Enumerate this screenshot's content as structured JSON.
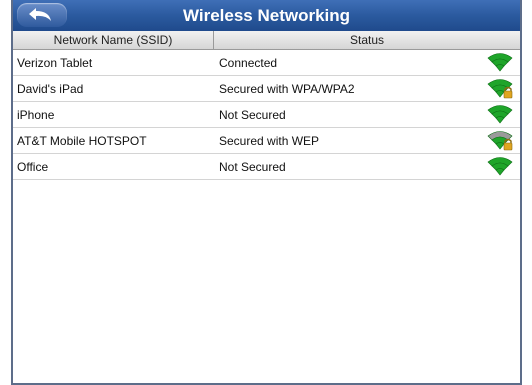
{
  "header": {
    "title": "Wireless Networking",
    "back_icon": "back-arrow-icon"
  },
  "table": {
    "columns": [
      "Network Name (SSID)",
      "Status"
    ],
    "rows": [
      {
        "ssid": "Verizon Tablet",
        "status": "Connected",
        "signal_icon": "wifi-icon",
        "locked": false,
        "color": "#1fa52a"
      },
      {
        "ssid": "David's iPad",
        "status": "Secured with WPA/WPA2",
        "signal_icon": "wifi-locked-icon",
        "locked": true,
        "color": "#1fa52a"
      },
      {
        "ssid": "iPhone",
        "status": "Not Secured",
        "signal_icon": "wifi-icon",
        "locked": false,
        "color": "#1fa52a"
      },
      {
        "ssid": "AT&T Mobile HOTSPOT",
        "status": "Secured with WEP",
        "signal_icon": "wifi-weak-locked-icon",
        "locked": true,
        "color": "#1fa52a"
      },
      {
        "ssid": "Office",
        "status": "Not Secured",
        "signal_icon": "wifi-icon",
        "locked": false,
        "color": "#1fa52a"
      }
    ]
  },
  "colors": {
    "title_bar": "#2b5a9f",
    "signal_green": "#1fa52a",
    "signal_grey": "#9a9a9a",
    "lock_gold": "#e0a520"
  }
}
